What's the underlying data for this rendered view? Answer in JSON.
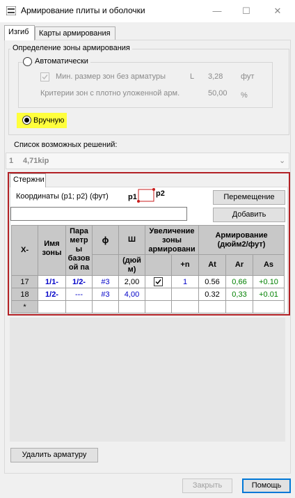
{
  "window": {
    "title": "Армирование плиты и оболочки",
    "minimize": "—",
    "maximize": "☐",
    "close": "✕"
  },
  "tabs": [
    {
      "label": "Изгиб"
    },
    {
      "label": "Карты армирования"
    }
  ],
  "zone_group": {
    "legend": "Определение зоны армирования",
    "auto_label": "Автоматически",
    "min_size_label": "Мин. размер зон без арматуры",
    "min_size_var": "L",
    "min_size_value": "3,28",
    "min_size_unit": "фут",
    "criteria_label": "Критерии зон с плотно уложенной арм.",
    "criteria_value": "50,00",
    "criteria_unit": "%",
    "manual_label": "Вручную"
  },
  "solutions": {
    "label": "Список возможных решений:",
    "selected_index": "1",
    "selected_value": "4,71kip"
  },
  "bars": {
    "tab_label": "Стержни",
    "coords_label": "Координаты (p1; p2) (фут)",
    "p1": "p1",
    "p2": "p2",
    "move_button": "Перемещение",
    "add_button": "Добавить",
    "headers": {
      "x": "X-",
      "zone_name": "Имя зоны",
      "params": "Пара метр ы базов ой па",
      "phi": "ϕ",
      "sh": "Ш",
      "sh_unit": "(дюй м)",
      "increase": "Увеличение зоны армировани",
      "plus_n": "+n",
      "reinf": "Армирование (дюйм2/фут)",
      "at": "At",
      "ar": "Ar",
      "as": "As"
    },
    "rows": [
      {
        "x": "17",
        "zone": "1/1-",
        "params": "1/2-",
        "phi": "#3",
        "sh": "2,00",
        "checked": true,
        "n": "1",
        "at": "0.56",
        "ar": "0,66",
        "as": "+0.10"
      },
      {
        "x": "18",
        "zone": "1/2-",
        "params": "---",
        "phi": "#3",
        "sh": "4,00",
        "checked": false,
        "n": "",
        "at": "0.32",
        "ar": "0,33",
        "as": "+0.01"
      }
    ],
    "new_row_marker": "*"
  },
  "footer": {
    "delete_button": "Удалить арматуру",
    "close_button": "Закрыть",
    "help_button": "Помощь"
  },
  "colors": {
    "highlight": "#ffff3c",
    "frame_red": "#b22024",
    "blue_text": "#0000c8",
    "green_text": "#008000"
  }
}
